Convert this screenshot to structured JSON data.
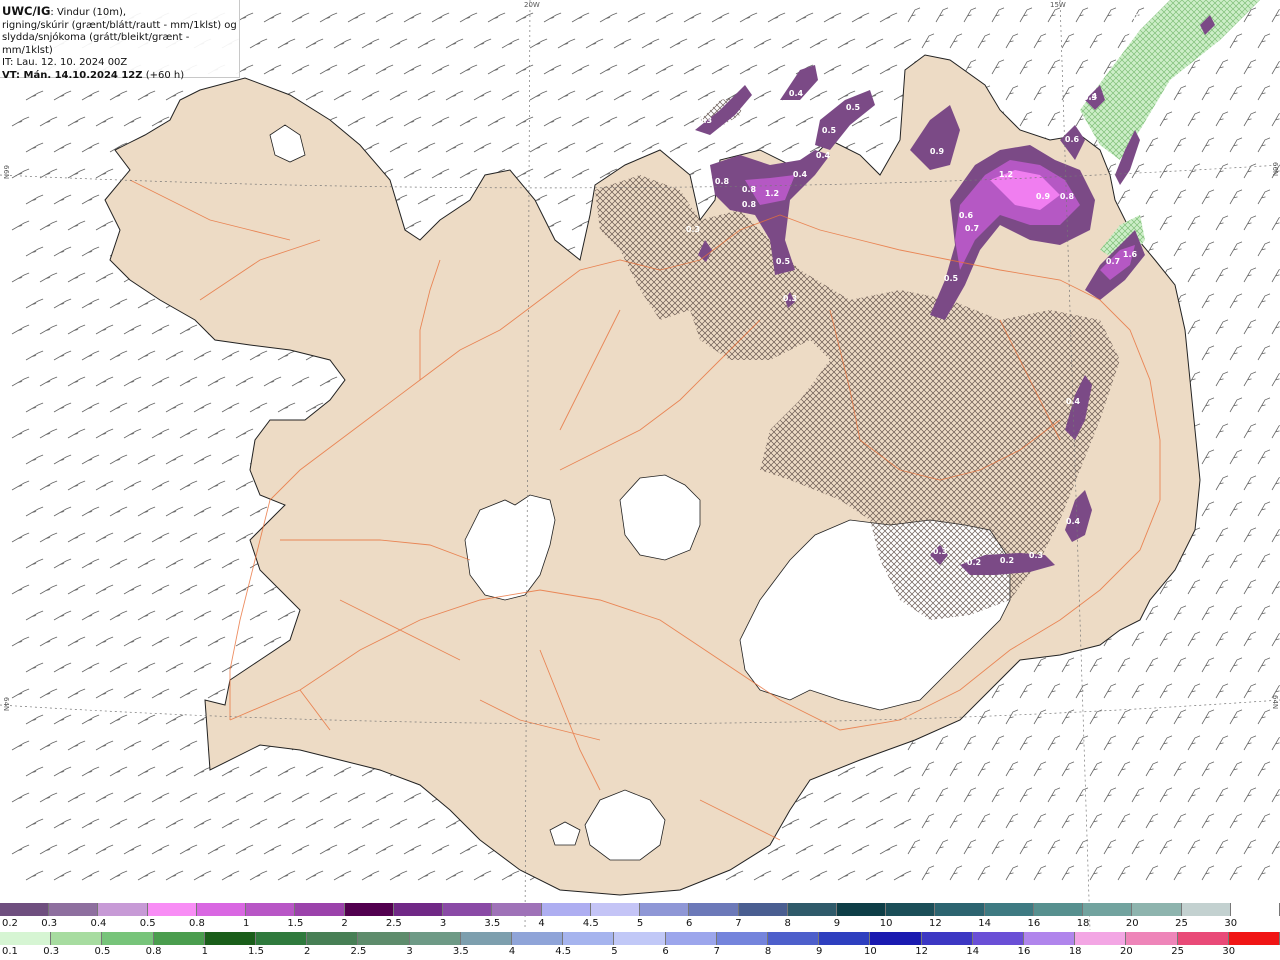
{
  "header": {
    "model": "UWC/IG",
    "line1_suffix": ": Vindur (10m),",
    "line2": "rigning/skúrir (grænt/blátt/rautt - mm/1klst) og",
    "line3": "slydda/snjókoma (grátt/bleikt/grænt - mm/1klst)",
    "init_time": "IT: Lau. 12. 10. 2024 00Z",
    "valid_time": "VT: Mán. 14.10.2024 12Z",
    "lead": "(+60 h)"
  },
  "grid_labels": {
    "lon_20w": "20W",
    "lon_15w": "15W",
    "lat_66n": "66N",
    "lat_64n": "64N"
  },
  "precip_labels": [
    "0.4",
    "0.4",
    "0.4",
    "0.3",
    "0.4",
    "0.5",
    "0.5",
    "0.4",
    "0.4",
    "0.8",
    "0.9",
    "1.2",
    "0.9",
    "0.8",
    "0.8",
    "0.3",
    "0.6",
    "0.2",
    "1.2",
    "0.8",
    "0.6",
    "0.7",
    "0.7",
    "1.6",
    "0.5",
    "0.5",
    "0.4",
    "0.4",
    "0.3",
    "0.2",
    "0.3",
    "0.3",
    "0.3"
  ],
  "colors": {
    "land": "#eddbc5",
    "sea": "#ffffff",
    "glacier": "#ffffff",
    "roads": "#e8703a",
    "snow_light": "#7b4a86",
    "snow_mid": "#b558c4",
    "snow_heavy": "#f07ef0",
    "rain_light": "#cdeec8",
    "hatch": "#5a4a44"
  },
  "legend_snow": {
    "labels": [
      "0.2",
      "0.3",
      "0.4",
      "0.5",
      "0.8",
      "1",
      "1.5",
      "2",
      "2.5",
      "3",
      "3.5",
      "4",
      "4.5",
      "5",
      "6",
      "7",
      "8",
      "9",
      "10",
      "12",
      "14",
      "16",
      "18",
      "20",
      "25",
      "30"
    ],
    "colors": [
      "#6f4f7f",
      "#8e6f9f",
      "#c79ad6",
      "#f88df5",
      "#d967e2",
      "#b856c6",
      "#9b42ab",
      "#52004f",
      "#702886",
      "#8a4aa6",
      "#9f72b8",
      "#aeaef1",
      "#c4c4f6",
      "#8f97d6",
      "#6c79b9",
      "#4a5e91",
      "#2f5a6a",
      "#0e3e47",
      "#1b4e58",
      "#2c6470",
      "#3e7a82",
      "#57908f",
      "#72a39f",
      "#8eb4ae",
      "#c3d1d0",
      "#ffffff"
    ]
  },
  "legend_rain": {
    "labels": [
      "0.1",
      "0.3",
      "0.5",
      "0.8",
      "1",
      "1.5",
      "2",
      "2.5",
      "3",
      "3.5",
      "4",
      "4.5",
      "5",
      "6",
      "7",
      "8",
      "9",
      "10",
      "12",
      "14",
      "16",
      "18",
      "20",
      "25",
      "30"
    ],
    "colors": [
      "#d6f5d3",
      "#a7dca0",
      "#77c47a",
      "#4a9d4e",
      "#1a5e1a",
      "#2f7a3d",
      "#477f55",
      "#5e8c6c",
      "#6e9a86",
      "#7d9fae",
      "#8fa4d8",
      "#a6b4ee",
      "#c1c8f7",
      "#9ca6ec",
      "#7484dc",
      "#4d5fcb",
      "#2e3fbf",
      "#1a1ab0",
      "#3c37c3",
      "#6a4fd6",
      "#b085ec",
      "#f3a6e4",
      "#ee85b9",
      "#e94a78",
      "#f01515"
    ]
  }
}
